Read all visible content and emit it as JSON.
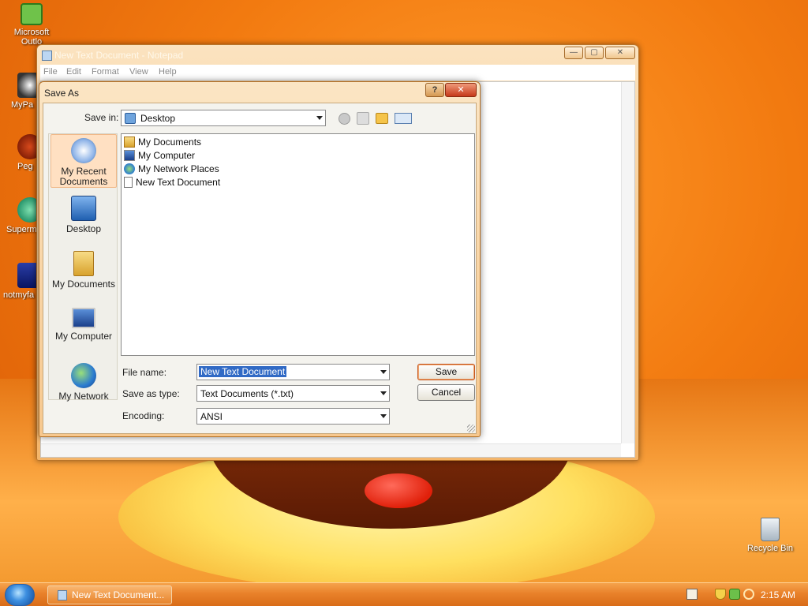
{
  "desktop": {
    "icons": [
      {
        "label": "Microsoft Outlo",
        "icon": "outlook-icon"
      },
      {
        "label": "MyPa",
        "icon": "mypa-icon"
      },
      {
        "label": "Peg",
        "icon": "peg-icon"
      },
      {
        "label": "Superm",
        "icon": "superm-icon"
      },
      {
        "label": "notmyfa",
        "icon": "notmyfa-icon"
      },
      {
        "label": "Recycle Bin",
        "icon": "recycle-bin-icon"
      }
    ]
  },
  "notepad": {
    "title": "New Text Document - Notepad",
    "menu": [
      "File",
      "Edit",
      "Format",
      "View",
      "Help"
    ],
    "controls": {
      "minimize": "—",
      "maximize": "▢",
      "close": "✕"
    }
  },
  "dialog": {
    "title": "Save As",
    "help_label": "?",
    "close_label": "✕",
    "save_in_label": "Save in:",
    "save_in_value": "Desktop",
    "places": [
      {
        "label": "My Recent Documents",
        "icon": "recent-documents-icon",
        "selected": true
      },
      {
        "label": "Desktop",
        "icon": "desktop-icon",
        "selected": false
      },
      {
        "label": "My Documents",
        "icon": "my-documents-folder-icon",
        "selected": false
      },
      {
        "label": "My Computer",
        "icon": "my-computer-icon",
        "selected": false
      },
      {
        "label": "My Network",
        "icon": "my-network-icon",
        "selected": false
      }
    ],
    "files": [
      {
        "label": "My Documents",
        "icon": "folder-icon"
      },
      {
        "label": "My Computer",
        "icon": "computer-icon"
      },
      {
        "label": "My Network Places",
        "icon": "network-places-icon"
      },
      {
        "label": "New Text Document",
        "icon": "text-document-icon"
      }
    ],
    "file_name_label": "File name:",
    "file_name_value": "New Text Document",
    "save_as_type_label": "Save as type:",
    "save_as_type_value": "Text Documents (*.txt)",
    "encoding_label": "Encoding:",
    "encoding_value": "ANSI",
    "save_button": "Save",
    "cancel_button": "Cancel"
  },
  "taskbar": {
    "task_label": "New Text Document...",
    "clock": "2:15 AM"
  },
  "colors": {
    "accent": "#e9812a",
    "selection": "#316ac5"
  }
}
